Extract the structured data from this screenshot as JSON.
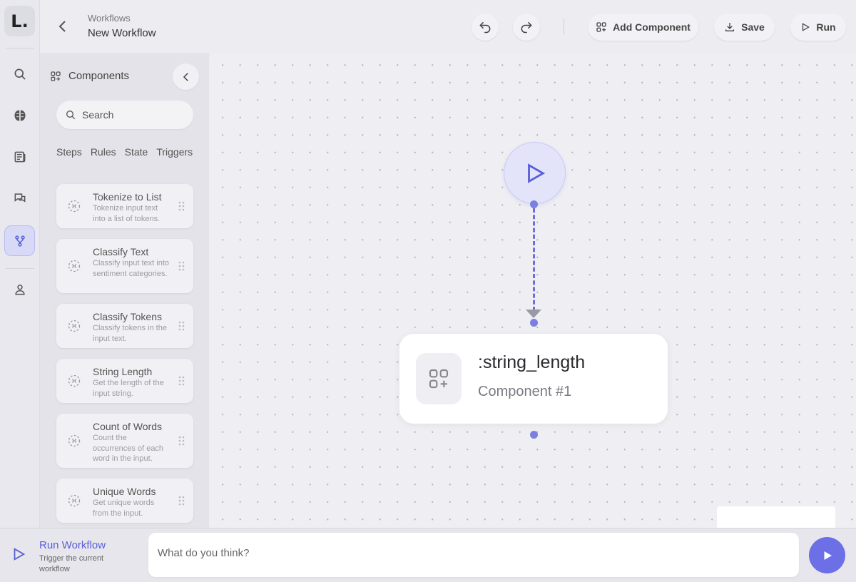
{
  "app": {
    "logo_letter": "L."
  },
  "rail": {
    "items": [
      {
        "name": "search",
        "icon": "search-icon"
      },
      {
        "name": "brain",
        "icon": "brain-icon"
      },
      {
        "name": "news",
        "icon": "newspaper-icon"
      },
      {
        "name": "chat",
        "icon": "chat-bubbles-icon"
      },
      {
        "name": "workflows",
        "icon": "workflow-icon",
        "active": true
      },
      {
        "name": "profile",
        "icon": "user-icon"
      }
    ]
  },
  "header": {
    "breadcrumb": "Workflows",
    "title": "New Workflow",
    "add_component_label": "Add Component",
    "save_label": "Save",
    "run_label": "Run"
  },
  "panel": {
    "title": "Components",
    "search_placeholder": "Search",
    "tabs": [
      "Steps",
      "Rules",
      "State",
      "Triggers"
    ],
    "components": [
      {
        "title": "Tokenize to List",
        "desc": "Tokenize input text into a list of tokens."
      },
      {
        "title": "Classify Text",
        "desc": "Classify input text into sentiment categories."
      },
      {
        "title": "Classify Tokens",
        "desc": "Classify tokens in the input text."
      },
      {
        "title": "String Length",
        "desc": "Get the length of the input string."
      },
      {
        "title": "Count of Words",
        "desc": "Count the occurrences of each word in the input."
      },
      {
        "title": "Unique Words",
        "desc": "Get unique words from the input."
      }
    ]
  },
  "canvas": {
    "node": {
      "name": ":string_length",
      "subtitle": "Component #1"
    }
  },
  "bottom": {
    "title": "Run Workflow",
    "desc": "Trigger the current workflow",
    "chat_placeholder": "What do you think?"
  },
  "colors": {
    "accent": "#6c6fe6",
    "accent_light": "#e3e4fa",
    "connector": "#6a6fdd"
  }
}
